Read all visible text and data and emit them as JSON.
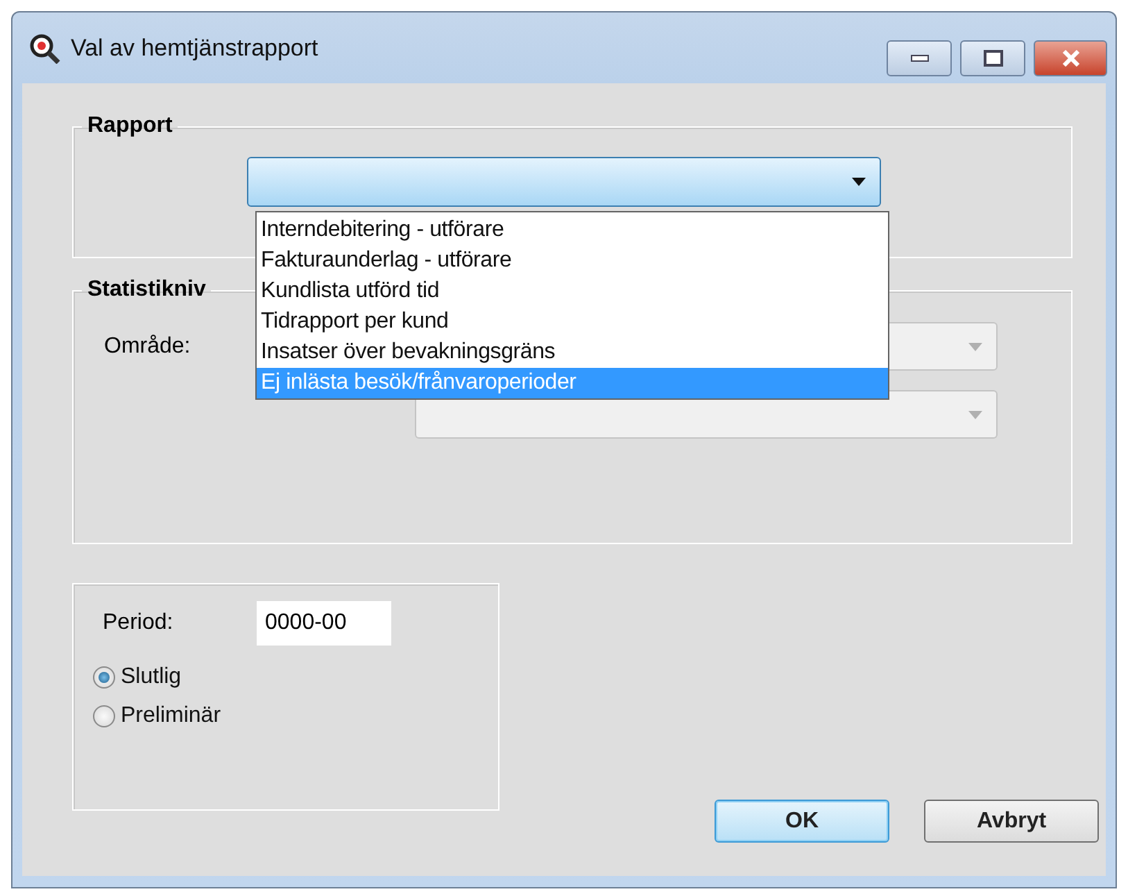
{
  "window": {
    "title": "Val av hemtjänstrapport"
  },
  "rapport": {
    "label": "Rapport",
    "options": [
      {
        "label": "Interndebitering - utförare",
        "selected": false
      },
      {
        "label": "Fakturaunderlag - utförare",
        "selected": false
      },
      {
        "label": "Kundlista utförd tid",
        "selected": false
      },
      {
        "label": "Tidrapport per kund",
        "selected": false
      },
      {
        "label": "Insatser över bevakningsgräns",
        "selected": false
      },
      {
        "label": "Ej inlästa besök/frånvaroperioder",
        "selected": true
      }
    ]
  },
  "statistik": {
    "label": "Statistikniv",
    "omrade_label": "Område:",
    "combos_disabled": true
  },
  "period": {
    "label": "Period:",
    "value": "0000-00",
    "options": [
      {
        "label": "Slutlig",
        "selected": true
      },
      {
        "label": "Preliminär",
        "selected": false
      }
    ]
  },
  "buttons": [
    {
      "label": "OK",
      "default": true
    },
    {
      "label": "Avbryt",
      "default": false
    }
  ]
}
